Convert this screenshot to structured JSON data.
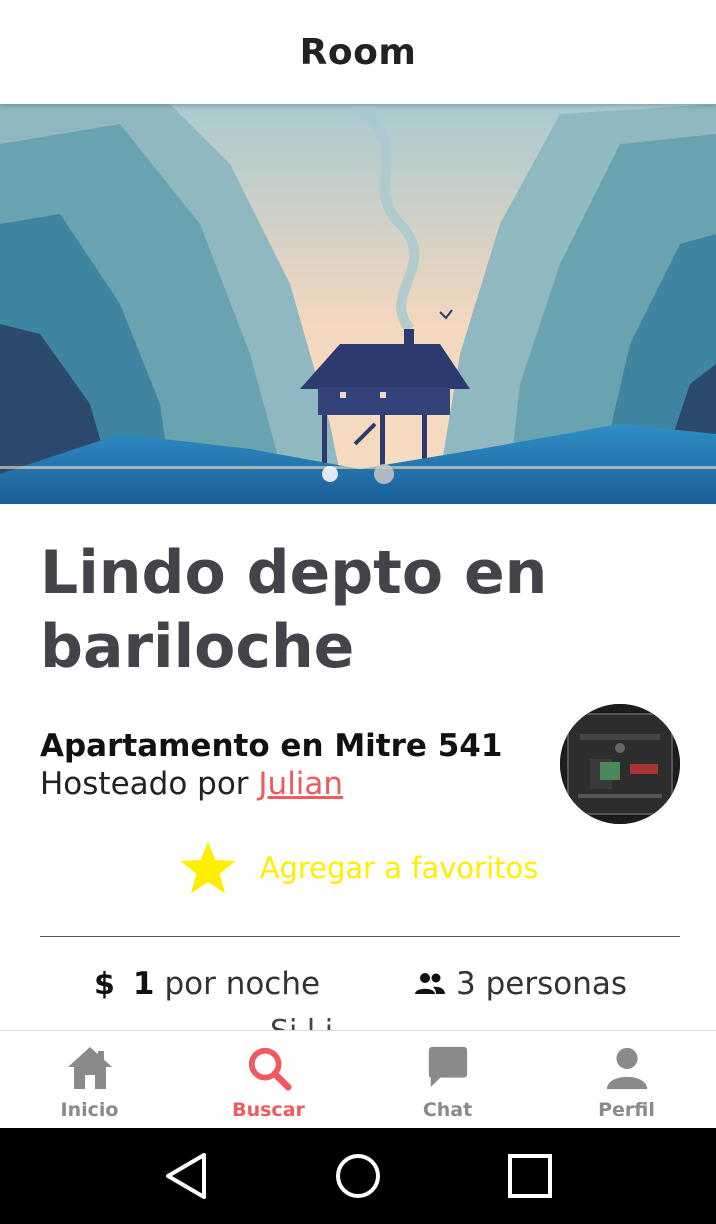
{
  "header": {
    "title": "Room"
  },
  "carousel": {
    "count": 2,
    "active_index": 0
  },
  "listing": {
    "title": "Lindo depto en bariloche",
    "subtitle": "Apartamento en Mitre 541",
    "hosted_prefix": "Hosteado por ",
    "host_name": "Julian",
    "favorite_label": "Agregar a favoritos",
    "price_symbol": "$",
    "price_value": "1",
    "price_unit": "por noche",
    "guests": "3 personas",
    "partial_text": "Si    l i"
  },
  "tabs": [
    {
      "label": "Inicio",
      "icon": "home-icon"
    },
    {
      "label": "Buscar",
      "icon": "search-icon"
    },
    {
      "label": "Chat",
      "icon": "chat-icon"
    },
    {
      "label": "Perfil",
      "icon": "person-icon"
    }
  ],
  "colors": {
    "accent": "#ef5a5f",
    "favorite": "#ffee00",
    "tab_inactive": "#8a8a8a"
  }
}
